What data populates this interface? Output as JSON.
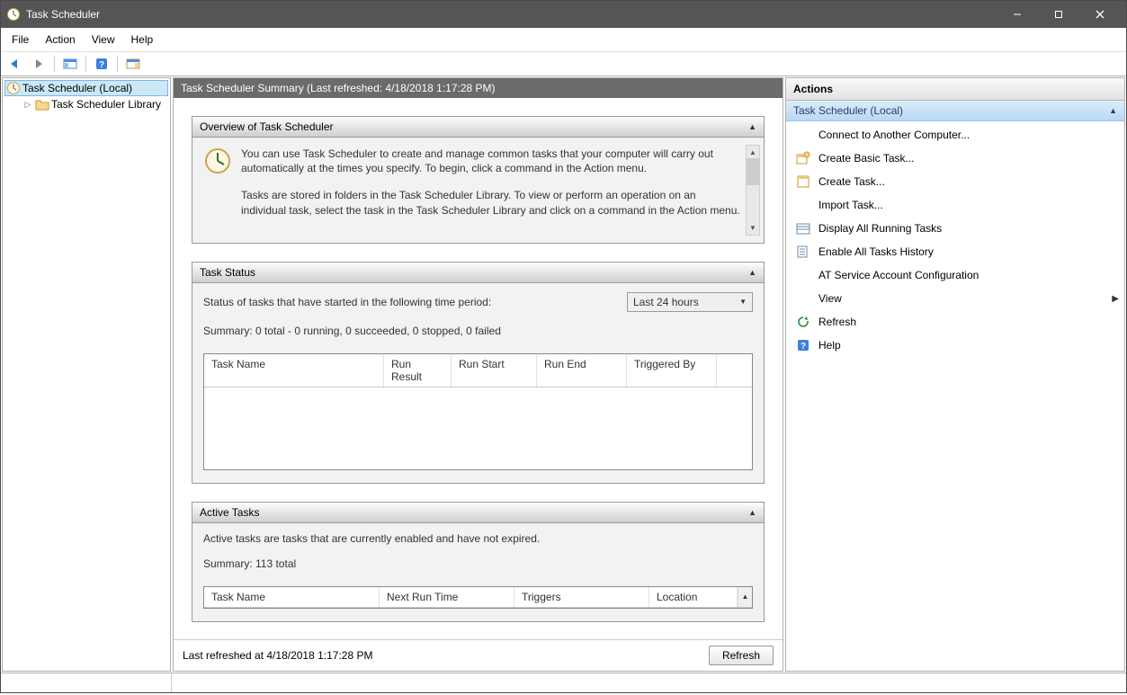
{
  "window": {
    "title": "Task Scheduler"
  },
  "menu": {
    "file": "File",
    "action": "Action",
    "view": "View",
    "help": "Help"
  },
  "tree": {
    "root": "Task Scheduler (Local)",
    "child": "Task Scheduler Library"
  },
  "center": {
    "header": "Task Scheduler Summary (Last refreshed: 4/18/2018 1:17:28 PM)",
    "overview_title": "Overview of Task Scheduler",
    "overview_p1": "You can use Task Scheduler to create and manage common tasks that your computer will carry out automatically at the times you specify. To begin, click a command in the Action menu.",
    "overview_p2": "Tasks are stored in folders in the Task Scheduler Library. To view or perform an operation on an individual task, select the task in the Task Scheduler Library and click on a command in the Action menu.",
    "task_status_title": "Task Status",
    "task_status_prompt": "Status of tasks that have started in the following time period:",
    "task_status_period": "Last 24 hours",
    "task_status_summary": "Summary: 0 total - 0 running, 0 succeeded, 0 stopped, 0 failed",
    "task_status_cols": {
      "c1": "Task Name",
      "c2": "Run Result",
      "c3": "Run Start",
      "c4": "Run End",
      "c5": "Triggered By"
    },
    "active_title": "Active Tasks",
    "active_prompt": "Active tasks are tasks that are currently enabled and have not expired.",
    "active_summary": "Summary: 113 total",
    "active_cols": {
      "c1": "Task Name",
      "c2": "Next Run Time",
      "c3": "Triggers",
      "c4": "Location"
    },
    "footer_text": "Last refreshed at 4/18/2018 1:17:28 PM",
    "footer_button": "Refresh"
  },
  "actions": {
    "panel_title": "Actions",
    "group_title": "Task Scheduler (Local)",
    "items": {
      "connect": "Connect to Another Computer...",
      "create_basic": "Create Basic Task...",
      "create_task": "Create Task...",
      "import": "Import Task...",
      "display_running": "Display All Running Tasks",
      "enable_history": "Enable All Tasks History",
      "at_config": "AT Service Account Configuration",
      "view": "View",
      "refresh": "Refresh",
      "help": "Help"
    }
  }
}
